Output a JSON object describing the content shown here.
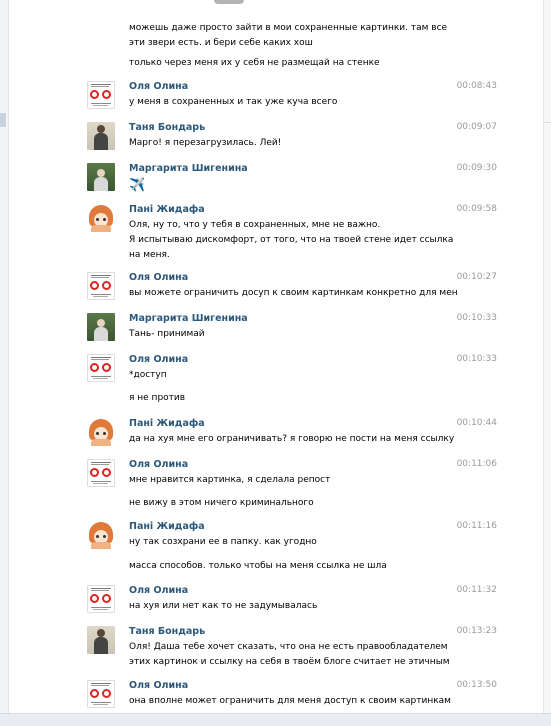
{
  "messages": [
    {
      "lines": [
        "можешь даже просто зайти в мои сохраненные картинки. там все",
        "эти звери есть. и бери себе каких хош"
      ]
    },
    {
      "lines": [
        "только через меня их у себя не размещай на стенке"
      ]
    },
    {
      "author": "Оля Олина",
      "avatar": "olya",
      "time": "00:08:43",
      "lines": [
        "у меня в сохраненных и так уже куча всего"
      ]
    },
    {
      "author": "Таня Бондарь",
      "avatar": "tanya",
      "time": "00:09:07",
      "lines": [
        "Марго! я перезагрузилась. Лей!"
      ]
    },
    {
      "author": "Маргарита Шигенина",
      "avatar": "margarita",
      "time": "00:09:30",
      "lines": [
        "✈️"
      ]
    },
    {
      "author": "Пані Жидафа",
      "avatar": "pani",
      "time": "00:09:58",
      "lines": [
        "Оля, ну то, что у тебя в сохраненных, мне не важно.",
        "Я испытываю дискомфорт, от того, что на твоей стене идет ссылка",
        "на меня."
      ]
    },
    {
      "author": "Оля Олина",
      "avatar": "olya",
      "time": "00:10:27",
      "lines": [
        "вы можете ограничить досуп к своим картинкам конкретно для мен"
      ]
    },
    {
      "author": "Маргарита Шигенина",
      "avatar": "margarita",
      "time": "00:10:33",
      "lines": [
        "Тань- принимай"
      ]
    },
    {
      "author": "Оля Олина",
      "avatar": "olya",
      "time": "00:10:33",
      "lines": [
        "*доступ"
      ]
    },
    {
      "lines": [
        "я не против"
      ]
    },
    {
      "author": "Пані Жидафа",
      "avatar": "pani",
      "time": "00:10:44",
      "lines": [
        "да на хуя мне его ограничивать? я говорю не пости на меня ссылку"
      ]
    },
    {
      "author": "Оля Олина",
      "avatar": "olya",
      "time": "00:11:06",
      "lines": [
        "мне нравится картинка, я сделала репост"
      ]
    },
    {
      "lines": [
        "не вижу в этом ничего криминального"
      ]
    },
    {
      "author": "Пані Жидафа",
      "avatar": "pani",
      "time": "00:11:16",
      "lines": [
        "ну так созхрани ее в папку. как угодно"
      ]
    },
    {
      "lines": [
        "масса способов. только чтобы на меня ссылка не шла"
      ]
    },
    {
      "author": "Оля Олина",
      "avatar": "olya",
      "time": "00:11:32",
      "lines": [
        "на хуя или нет как то не задумывалась"
      ]
    },
    {
      "author": "Таня Бондарь",
      "avatar": "tanya",
      "time": "00:13:23",
      "lines": [
        "Оля! Даша тебе хочет сказать, что она не есть правообладателем",
        "этих картинок и ссылку на себя в твоём блоге считает не этичным"
      ]
    },
    {
      "author": "Оля Олина",
      "avatar": "olya",
      "time": "00:13:50",
      "lines": [
        "она вполне может ограничить для меня доступ к своим картинкам"
      ]
    }
  ]
}
